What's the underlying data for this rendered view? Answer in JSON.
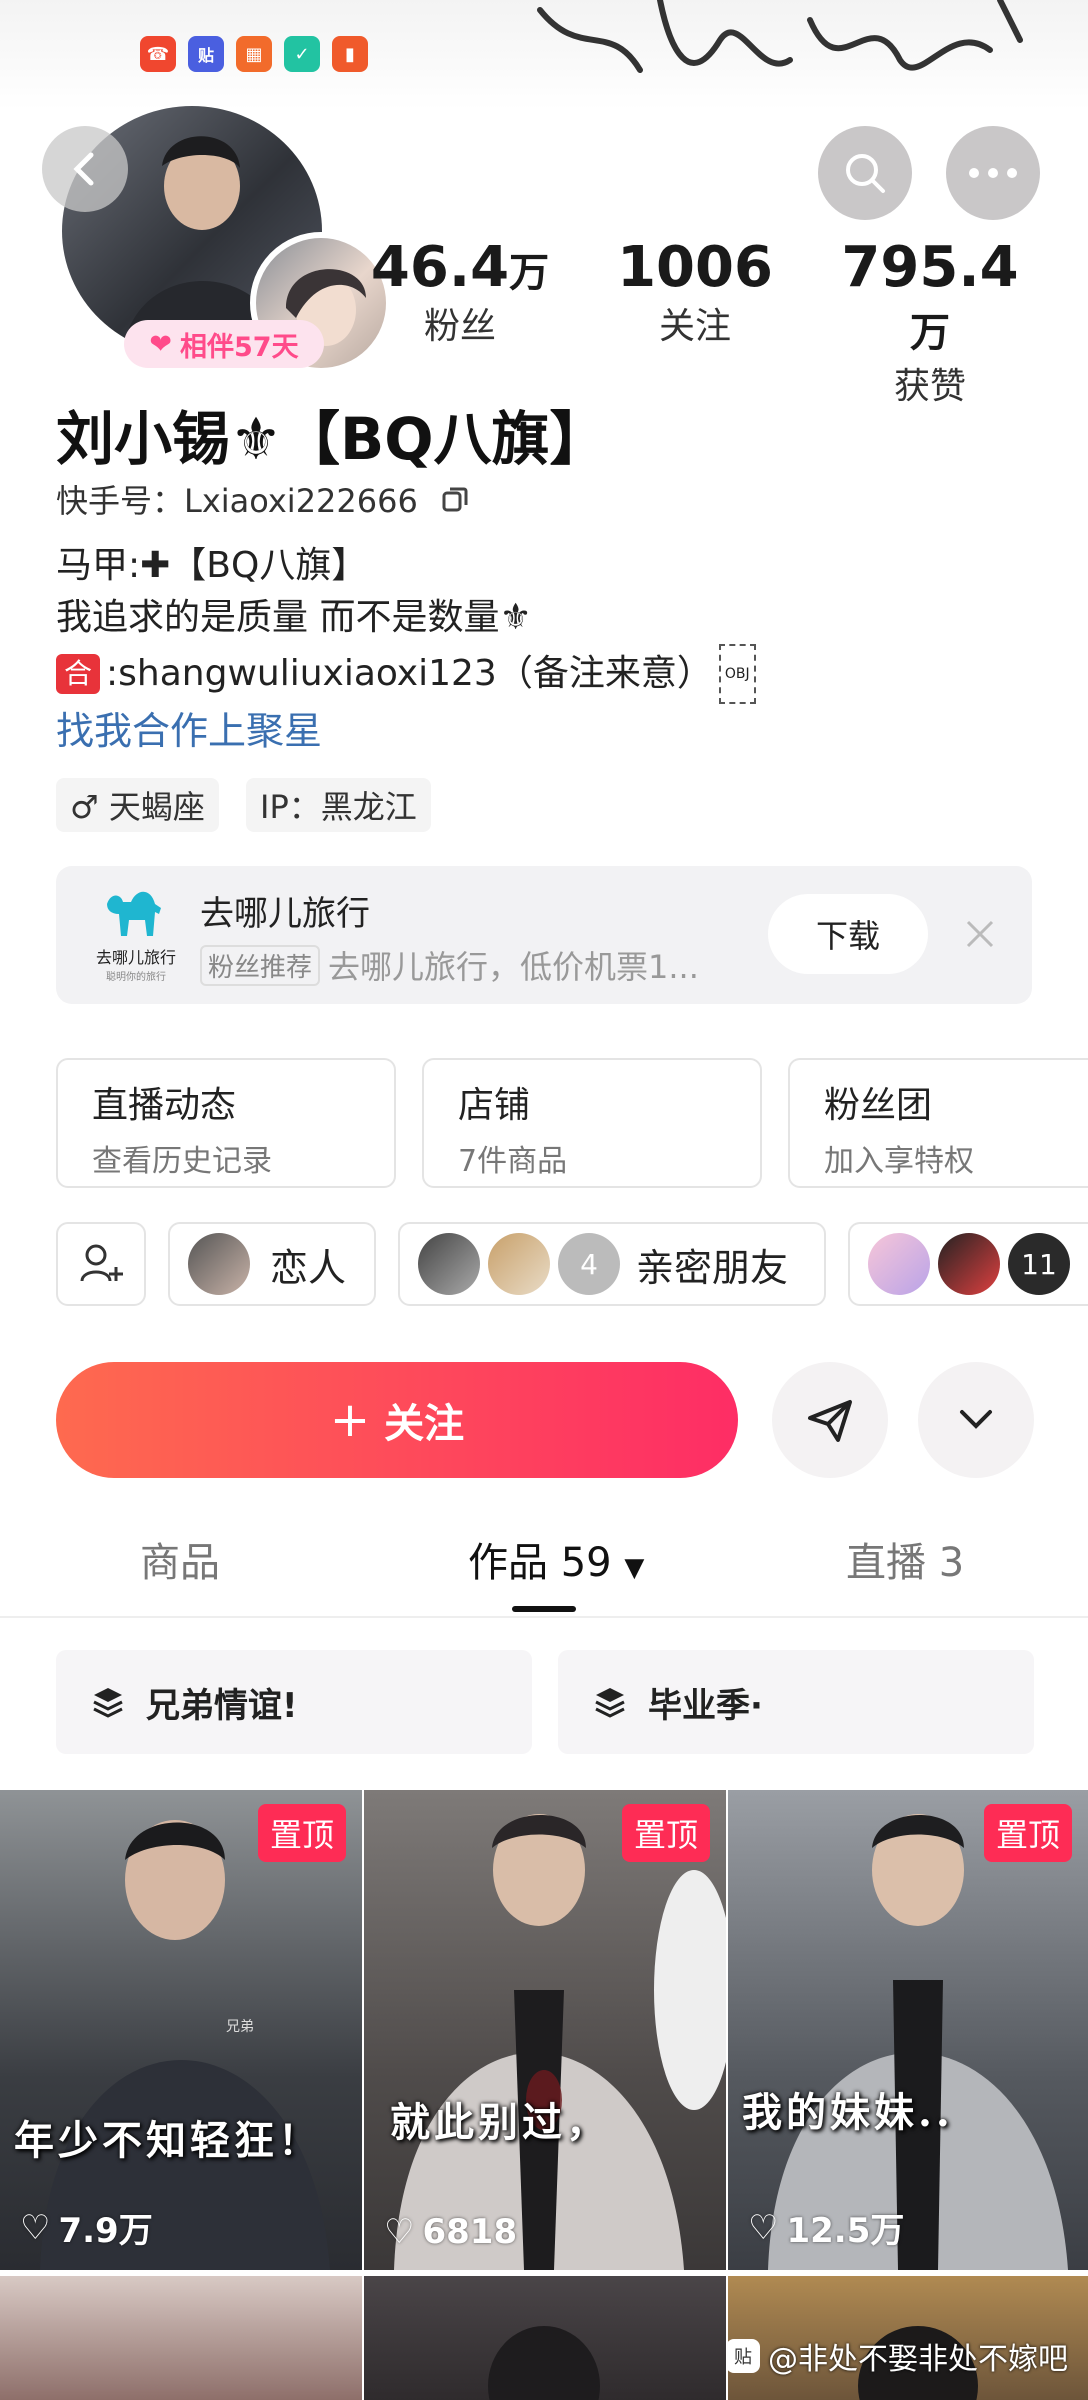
{
  "header": {
    "status_icons": [
      {
        "name": "phone-app-icon",
        "color": "#f0472f",
        "glyph": "☎"
      },
      {
        "name": "tieba-app-icon",
        "color": "#4a5fe0",
        "glyph": "贴"
      },
      {
        "name": "grid-app-icon",
        "color": "#f26b2b",
        "glyph": "▦"
      },
      {
        "name": "shield-app-icon",
        "color": "#22c3a2",
        "glyph": "✓"
      },
      {
        "name": "battery-app-icon",
        "color": "#f05a2b",
        "glyph": "▮"
      }
    ]
  },
  "profile": {
    "days_badge": "相伴57天",
    "stats": [
      {
        "num": "46.4",
        "unit": "万",
        "label": "粉丝"
      },
      {
        "num": "1006",
        "unit": "",
        "label": "关注"
      },
      {
        "num": "795.4",
        "unit": "万",
        "label": "获赞"
      }
    ],
    "name": "刘小锡⚜【BQ八旗】",
    "kuaishou_id": "快手号：Lxiaoxi222666",
    "bio": [
      "马甲:✚【BQ八旗】",
      "我追求的是质量 而不是数量⚜",
      ":shangwuliuxiaoxi123（备注来意）"
    ],
    "bio_badge": "合",
    "obj_mark": "OBJ",
    "link": "找我合作上聚星",
    "chips": [
      "♂ 天蝎座",
      "IP：黑龙江"
    ]
  },
  "ad": {
    "logo_text": "去哪儿旅行",
    "logo_sub": "聪明你的旅行",
    "title": "去哪儿旅行",
    "tag": "粉丝推荐",
    "desc": "去哪儿旅行，低价机票1...",
    "button": "下载"
  },
  "features": [
    {
      "title": "直播动态",
      "sub": "查看历史记录"
    },
    {
      "title": "店铺",
      "sub": "7件商品"
    },
    {
      "title": "粉丝团",
      "sub": "加入享特权"
    }
  ],
  "relations": {
    "lover": "恋人",
    "friends": "亲密朋友",
    "friends_count": "4",
    "more_count": "11"
  },
  "actions": {
    "follow": "关注"
  },
  "tabs": {
    "goods": "商品",
    "works": "作品 59",
    "live": "直播 3"
  },
  "collections": [
    "兄弟情谊!",
    "毕业季·"
  ],
  "videos": [
    {
      "pin": "置顶",
      "caption": "年少不知轻狂！",
      "likes": "7.9万",
      "label": "兄弟"
    },
    {
      "pin": "置顶",
      "caption": "就此别过，",
      "likes": "6818"
    },
    {
      "pin": "置顶",
      "caption": "我的妹妹..",
      "likes": "12.5万"
    }
  ],
  "watermark": "@非处不娶非处不嫁吧",
  "watermark_icon": "贴",
  "colors": {
    "accent": "#fe2c55",
    "link": "#3a6fb0",
    "follow_start": "#fe6a4f",
    "follow_end": "#fe2d65"
  }
}
